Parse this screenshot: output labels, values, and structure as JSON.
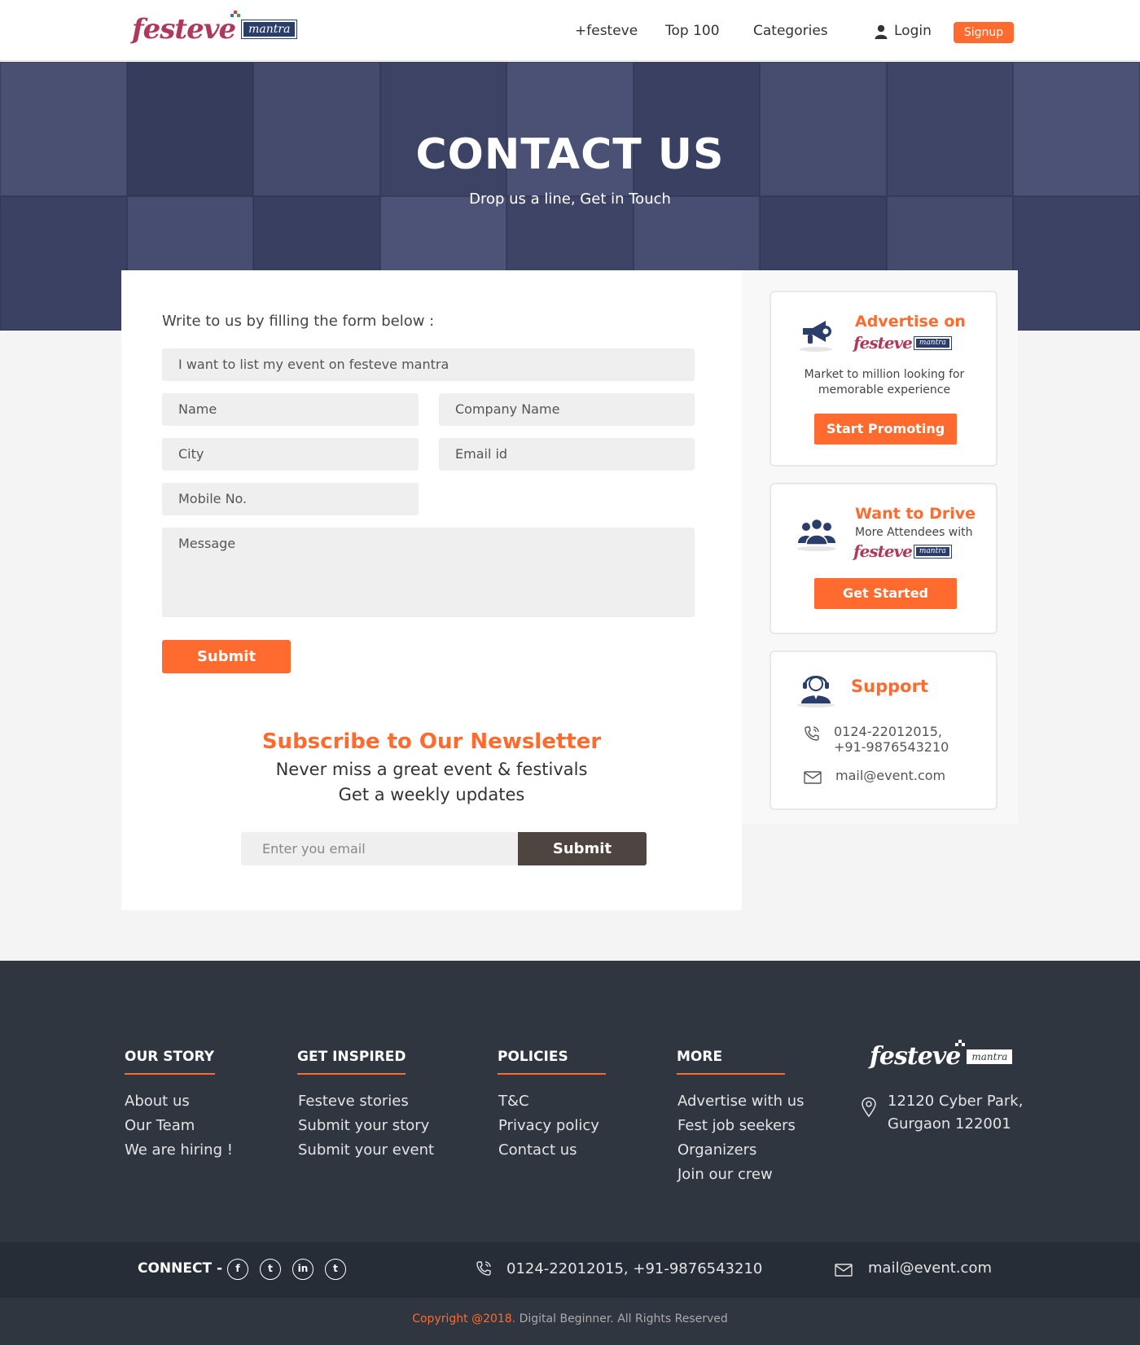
{
  "header": {
    "logo": {
      "word": "festeve",
      "badge": "mantra"
    },
    "nav": [
      {
        "label": "+festeve"
      },
      {
        "label": "Top 100"
      },
      {
        "label": "Categories"
      }
    ],
    "login": "Login",
    "signup": "Signup"
  },
  "hero": {
    "title": "CONTACT US",
    "subtitle": "Drop us a line, Get in Touch"
  },
  "form": {
    "intro": "Write to us by filling the form below :",
    "topic": "I want to list my event on festeve mantra",
    "name": "Name",
    "company": "Company Name",
    "city": "City",
    "email": "Email id",
    "mobile": "Mobile No.",
    "message": "Message",
    "submit": "Submit"
  },
  "newsletter": {
    "title": "Subscribe to Our Newsletter",
    "line1": "Never miss a great event & festivals",
    "line2": "Get a weekly updates",
    "placeholder": "Enter you email",
    "submit": "Submit"
  },
  "sidebar": {
    "advertise": {
      "title": "Advertise on",
      "text": "Market to million looking for memorable experience",
      "button": "Start Promoting"
    },
    "drive": {
      "title": "Want to Drive",
      "text": "More Attendees with",
      "button": "Get Started"
    },
    "support": {
      "title": "Support",
      "phone1": "0124-22012015,",
      "phone2": "+91-9876543210",
      "email": "mail@event.com"
    }
  },
  "footer": {
    "columns": [
      {
        "heading": "OUR STORY",
        "links": [
          "About us",
          "Our Team",
          "We are hiring !"
        ]
      },
      {
        "heading": "GET INSPIRED",
        "links": [
          "Festeve stories",
          "Submit your story",
          "Submit your event"
        ]
      },
      {
        "heading": "POLICIES",
        "links": [
          "T&C",
          "Privacy policy",
          "Contact us"
        ]
      },
      {
        "heading": "MORE",
        "links": [
          "Advertise with us",
          "Fest job seekers",
          "Organizers",
          "Join our crew"
        ]
      }
    ],
    "address1": "12120 Cyber Park,",
    "address2": "Gurgaon 122001",
    "connect": "CONNECT -",
    "social": [
      "facebook-icon",
      "twitter-icon",
      "linkedin-icon",
      "twitter-icon"
    ],
    "phone": "0124-22012015, +91-9876543210",
    "email": "mail@event.com",
    "copyright_year": "Copyright @2018.",
    "copyright_rest": "Digital Beginner. All Rights Reserved"
  },
  "colors": {
    "accent": "#ff6a2e",
    "navy": "#2b3d6b",
    "footer": "#2f3640",
    "hero": "#3a4163"
  }
}
